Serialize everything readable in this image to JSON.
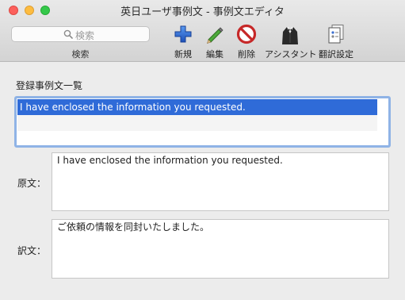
{
  "window": {
    "title": "英日ユーザ事例文 - 事例文エディタ"
  },
  "toolbar": {
    "search_placeholder": "検索",
    "search_label": "検索",
    "buttons": [
      {
        "id": "new",
        "label": "新規",
        "icon": "plus-icon"
      },
      {
        "id": "edit",
        "label": "編集",
        "icon": "pencil-icon"
      },
      {
        "id": "delete",
        "label": "削除",
        "icon": "no-entry-icon"
      },
      {
        "id": "assistant",
        "label": "アシスタント",
        "icon": "butler-icon"
      },
      {
        "id": "translation_settings",
        "label": "翻訳設定",
        "icon": "document-settings-icon"
      }
    ]
  },
  "list": {
    "title": "登録事例文一覧",
    "rows": [
      "I have enclosed the information you requested.",
      "",
      ""
    ],
    "selected_index": 0
  },
  "source": {
    "label": "原文：",
    "text": "I have enclosed the information you requested."
  },
  "translation": {
    "label": "訳文：",
    "text": "ご依頼の情報を同封いたしました。"
  },
  "colors": {
    "selection": "#2f6bd8",
    "focus_ring": "#8fb3e6",
    "close": "#fc605c",
    "minimize": "#fdbc40",
    "zoom": "#34c84a"
  }
}
